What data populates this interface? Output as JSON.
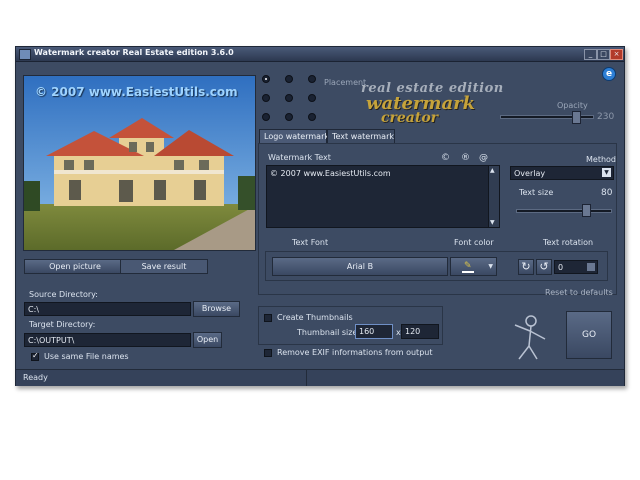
{
  "window": {
    "title": "Watermark creator Real Estate edition 3.6.0",
    "buttons": {
      "minimize": "_",
      "maximize": "□",
      "close": "×"
    }
  },
  "preview": {
    "overlay_text": "© 2007 www.EasiestUtils.com"
  },
  "buttons": {
    "open_picture": "Open picture",
    "save_result": "Save result",
    "browse": "Browse",
    "open": "Open",
    "go": "GO"
  },
  "source": {
    "label": "Source Directory:",
    "value": "C:\\"
  },
  "target": {
    "label": "Target Directory:",
    "value": "C:\\OUTPUT\\"
  },
  "use_same_names": {
    "label": "Use same File names",
    "checked": true
  },
  "placement": {
    "label": "Placement",
    "selected_index": 0
  },
  "logo": {
    "line1": "real estate edition",
    "line2": "watermark",
    "line3": "creator"
  },
  "opacity": {
    "label": "Opacity",
    "value": "230"
  },
  "tabs": [
    {
      "label": "Logo watermark"
    },
    {
      "label": "Text watermark"
    }
  ],
  "watermark_text": {
    "label": "Watermark Text",
    "value": "© 2007 www.EasiestUtils.com",
    "symbols": [
      "©",
      "®",
      "@"
    ]
  },
  "method": {
    "label": "Method",
    "value": "Overlay"
  },
  "text_size": {
    "label": "Text size",
    "value": "80"
  },
  "text_font": {
    "label": "Text Font",
    "value": "Arial B"
  },
  "font_color": {
    "label": "Font color"
  },
  "text_rotation": {
    "label": "Text rotation",
    "value": "0"
  },
  "reset": {
    "label": "Reset to defaults"
  },
  "thumbnails": {
    "label": "Create Thumbnails",
    "size_label": "Thumbnail size",
    "width": "160",
    "separator": "x",
    "height": "120"
  },
  "exif": {
    "label": "Remove EXIF informations from output"
  },
  "status": {
    "text": "Ready"
  },
  "colors": {
    "window_bg": "#3d4b63",
    "logo_gold": "#c6a33a",
    "field_bg": "#1e2636"
  }
}
